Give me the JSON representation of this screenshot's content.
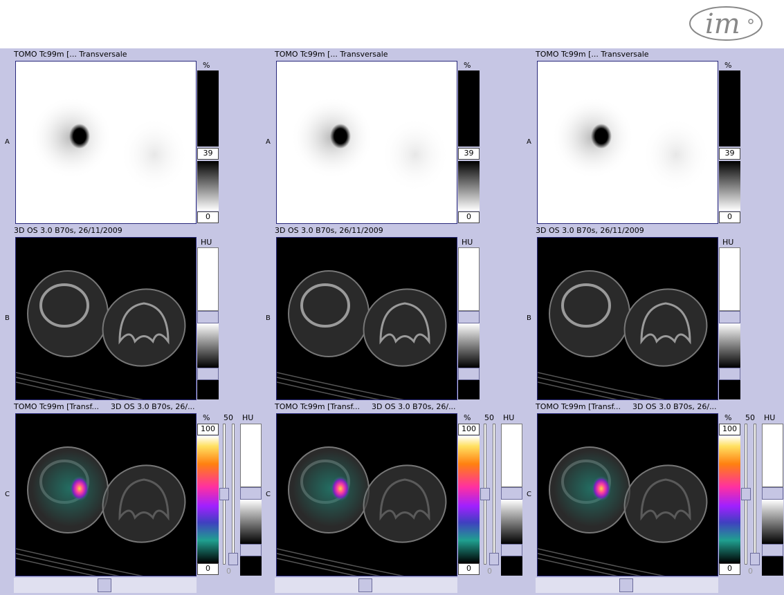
{
  "logo": {
    "text": "im"
  },
  "columns": [
    {
      "nm": {
        "title": "TOMO Tc99m [...  Transversale",
        "unit": "%",
        "max": "39",
        "min": "0"
      },
      "ct": {
        "title": "3D OS  3.0  B70s, 26/11/2009",
        "unit": "HU"
      },
      "fusion": {
        "title1": "TOMO Tc99m [Transf...",
        "title2": "3D OS  3.0  B70s, 26/...",
        "unit_nm": "%",
        "max": "100",
        "min": "0",
        "opacity": "50",
        "opacity_min": "0",
        "unit_ct": "HU"
      }
    },
    {
      "nm": {
        "title": "TOMO Tc99m [...  Transversale",
        "unit": "%",
        "max": "39",
        "min": "0"
      },
      "ct": {
        "title": "3D OS  3.0  B70s, 26/11/2009",
        "unit": "HU"
      },
      "fusion": {
        "title1": "TOMO Tc99m [Transf...",
        "title2": "3D OS  3.0  B70s, 26/...",
        "unit_nm": "%",
        "max": "100",
        "min": "0",
        "opacity": "50",
        "opacity_min": "0",
        "unit_ct": "HU"
      }
    },
    {
      "nm": {
        "title": "TOMO Tc99m [...  Transversale",
        "unit": "%",
        "max": "39",
        "min": "0"
      },
      "ct": {
        "title": "3D OS  3.0  B70s, 26/11/2009",
        "unit": "HU"
      },
      "fusion": {
        "title1": "TOMO Tc99m [Transf...",
        "title2": "3D OS  3.0  B70s, 26/...",
        "unit_nm": "%",
        "max": "100",
        "min": "0",
        "opacity": "50",
        "opacity_min": "0",
        "unit_ct": "HU"
      }
    }
  ],
  "rows": {
    "a": "A",
    "b": "B",
    "c": "C"
  },
  "colors": {
    "background": "#c6c6e4",
    "frame": "#27277a"
  },
  "icons": {
    "logo": "im-logo"
  }
}
